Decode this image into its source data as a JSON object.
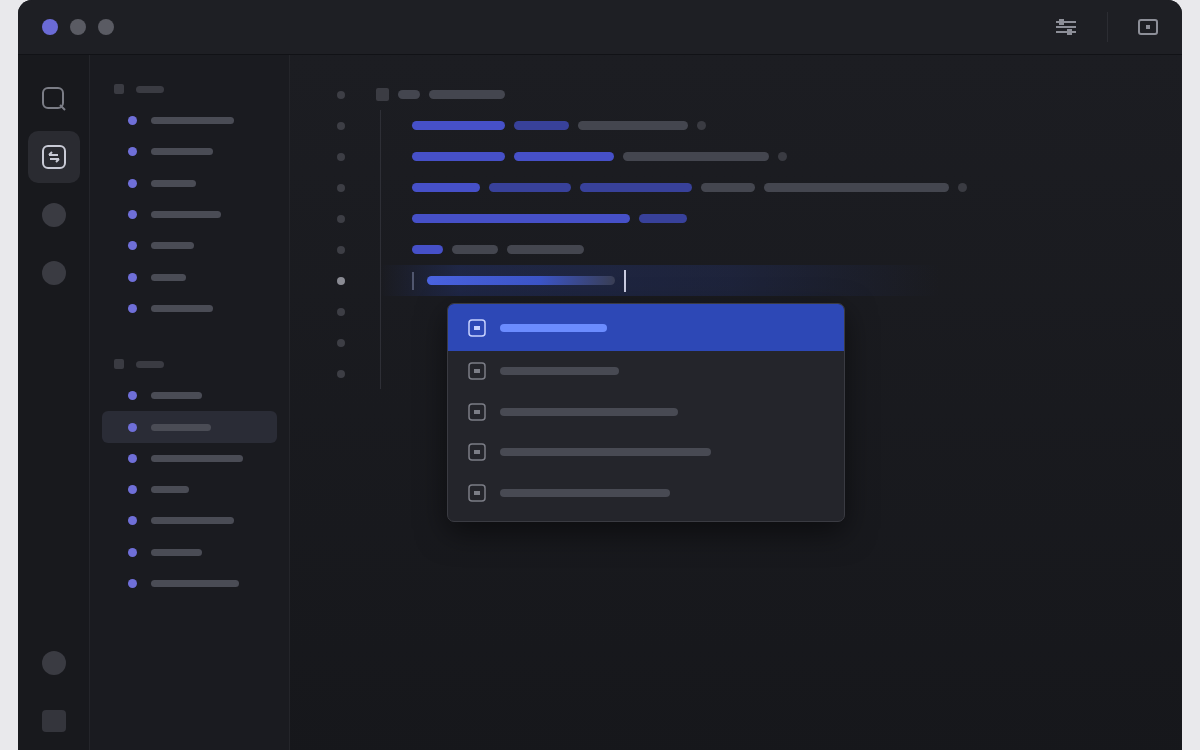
{
  "window": {
    "traffic_lights": [
      {
        "color": "#6b6bd6"
      },
      {
        "color": "#5a5b63"
      },
      {
        "color": "#5a5b63"
      }
    ]
  },
  "activity_bar": [
    {
      "kind": "search",
      "selected": false
    },
    {
      "kind": "files",
      "selected": true
    },
    {
      "kind": "circle",
      "selected": false
    },
    {
      "kind": "circle",
      "selected": false
    }
  ],
  "activity_bottom": [
    {
      "kind": "circle"
    },
    {
      "kind": "square"
    }
  ],
  "sidebar": {
    "groups": [
      {
        "items": [
          {
            "selected": false
          },
          {
            "selected": false
          },
          {
            "selected": false
          },
          {
            "selected": false
          },
          {
            "selected": false
          },
          {
            "selected": false
          },
          {
            "selected": false
          }
        ]
      },
      {
        "items": [
          {
            "selected": false
          },
          {
            "selected": true
          },
          {
            "selected": false
          },
          {
            "selected": false
          },
          {
            "selected": false
          },
          {
            "selected": false
          },
          {
            "selected": false
          }
        ]
      }
    ]
  },
  "editor": {
    "lines": [
      {
        "current": false,
        "tokens": [
          {
            "kind": "mark"
          },
          {
            "kind": "text"
          },
          {
            "kind": "text"
          }
        ]
      },
      {
        "current": false,
        "tokens": [
          {
            "kind": "keyword"
          },
          {
            "kind": "type"
          },
          {
            "kind": "text"
          },
          {
            "kind": "dot"
          }
        ]
      },
      {
        "current": false,
        "tokens": [
          {
            "kind": "keyword"
          },
          {
            "kind": "keyword"
          },
          {
            "kind": "text"
          },
          {
            "kind": "dot"
          }
        ]
      },
      {
        "current": false,
        "tokens": [
          {
            "kind": "keyword"
          },
          {
            "kind": "type"
          },
          {
            "kind": "type"
          },
          {
            "kind": "text"
          },
          {
            "kind": "text"
          },
          {
            "kind": "dot"
          }
        ]
      },
      {
        "current": false,
        "tokens": [
          {
            "kind": "keyword"
          },
          {
            "kind": "type"
          }
        ]
      },
      {
        "current": false,
        "tokens": [
          {
            "kind": "keyword"
          },
          {
            "kind": "text"
          },
          {
            "kind": "text"
          }
        ]
      },
      {
        "current": true,
        "tokens": [
          {
            "kind": "input"
          }
        ]
      },
      {
        "current": false
      },
      {
        "current": false
      },
      {
        "current": false
      }
    ]
  },
  "completion": {
    "items": [
      {
        "selected": true
      },
      {
        "selected": false
      },
      {
        "selected": false
      },
      {
        "selected": false
      },
      {
        "selected": false
      }
    ]
  }
}
